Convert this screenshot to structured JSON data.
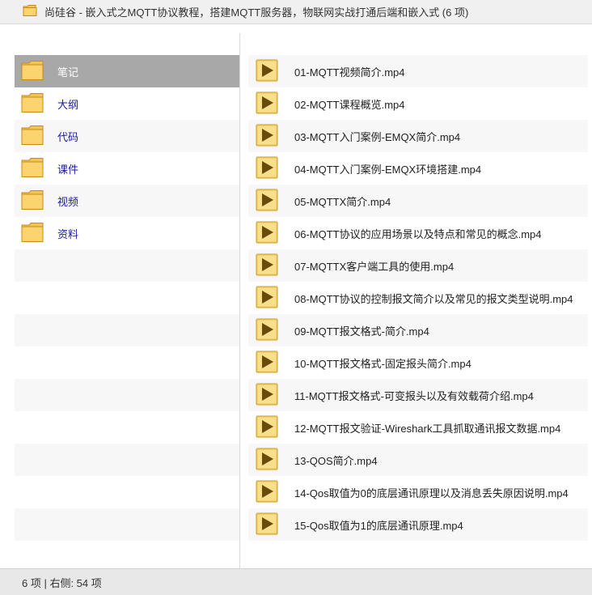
{
  "window": {
    "title": "尚硅谷 - 嵌入式之MQTT协议教程，搭建MQTT服务器，物联网实战打通后端和嵌入式 (6 项)"
  },
  "sidebar": {
    "items": [
      {
        "label": "笔记",
        "selected": true
      },
      {
        "label": "大纲",
        "selected": false
      },
      {
        "label": "代码",
        "selected": false
      },
      {
        "label": "课件",
        "selected": false
      },
      {
        "label": "视频",
        "selected": false
      },
      {
        "label": "资料",
        "selected": false
      }
    ]
  },
  "files": [
    "01-MQTT视频简介.mp4",
    "02-MQTT课程概览.mp4",
    "03-MQTT入门案例-EMQX简介.mp4",
    "04-MQTT入门案例-EMQX环境搭建.mp4",
    "05-MQTTX简介.mp4",
    "06-MQTT协议的应用场景以及特点和常见的概念.mp4",
    "07-MQTTX客户端工具的使用.mp4",
    "08-MQTT协议的控制报文简介以及常见的报文类型说明.mp4",
    "09-MQTT报文格式-简介.mp4",
    "10-MQTT报文格式-固定报头简介.mp4",
    "11-MQTT报文格式-可变报头以及有效载荷介绍.mp4",
    "12-MQTT报文验证-Wireshark工具抓取通讯报文数据.mp4",
    "13-QOS简介.mp4",
    "14-Qos取值为0的底层通讯原理以及消息丢失原因说明.mp4",
    "15-Qos取值为1的底层通讯原理.mp4"
  ],
  "status": {
    "text": "6 项 | 右侧: 54 项"
  },
  "icons": {
    "folder": "folder-icon",
    "video": "video-file-icon"
  },
  "colors": {
    "folder_fill": "#f8c44f",
    "folder_stroke": "#c88a1a",
    "play_fill": "#f5d36b",
    "play_triangle": "#6a4a08",
    "selected_bg": "#a8a8a8",
    "link_text": "#1a1aa8"
  }
}
